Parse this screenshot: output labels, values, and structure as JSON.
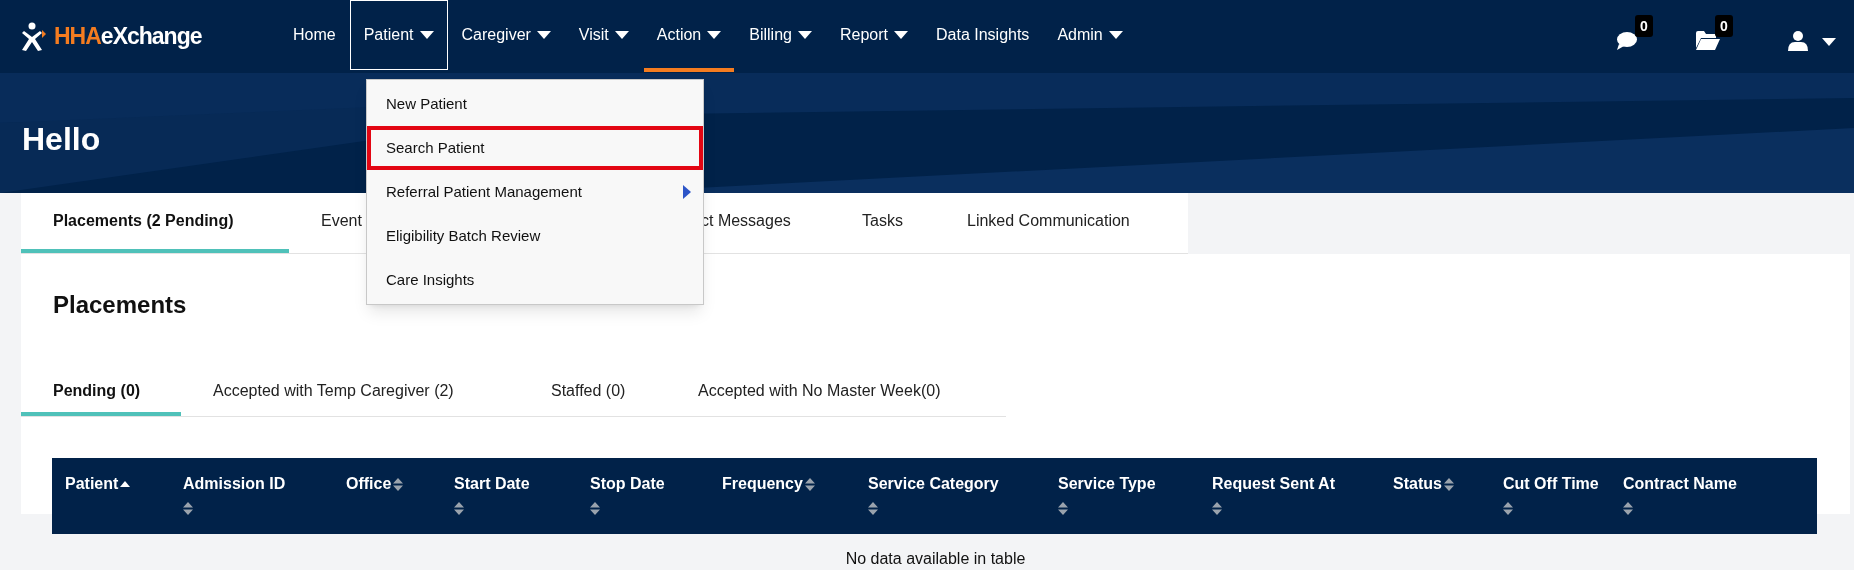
{
  "logo": {
    "prefix": "HHA",
    "suffix": "eXchange"
  },
  "nav": [
    {
      "label": "Home",
      "has_menu": false,
      "open": false,
      "active": false
    },
    {
      "label": "Patient",
      "has_menu": true,
      "open": true,
      "active": false
    },
    {
      "label": "Caregiver",
      "has_menu": true,
      "open": false,
      "active": false
    },
    {
      "label": "Visit",
      "has_menu": true,
      "open": false,
      "active": false
    },
    {
      "label": "Action",
      "has_menu": true,
      "open": false,
      "active": true
    },
    {
      "label": "Billing",
      "has_menu": true,
      "open": false,
      "active": false
    },
    {
      "label": "Report",
      "has_menu": true,
      "open": false,
      "active": false
    },
    {
      "label": "Data Insights",
      "has_menu": false,
      "open": false,
      "active": false
    },
    {
      "label": "Admin",
      "has_menu": true,
      "open": false,
      "active": false
    }
  ],
  "header_icons": [
    {
      "kind": "chat",
      "badge": "0"
    },
    {
      "kind": "folder",
      "badge": "0"
    },
    {
      "kind": "user"
    }
  ],
  "greeting": "Hello",
  "patient_menu": [
    {
      "label": "New Patient",
      "highlighted": false,
      "has_submenu": false
    },
    {
      "label": "Search Patient",
      "highlighted": true,
      "has_submenu": false
    },
    {
      "label": "Referral Patient Management",
      "highlighted": false,
      "has_submenu": true
    },
    {
      "label": "Eligibility Batch Review",
      "highlighted": false,
      "has_submenu": false
    },
    {
      "label": "Care Insights",
      "highlighted": false,
      "has_submenu": false
    }
  ],
  "tabs": [
    {
      "label": "Placements (2 Pending)",
      "selected": true
    },
    {
      "label": "Event",
      "selected": false
    },
    {
      "label": "ct Messages",
      "selected": false
    },
    {
      "label": "Tasks",
      "selected": false
    },
    {
      "label": "Linked Communication",
      "selected": false
    }
  ],
  "section_title": "Placements",
  "sub_tabs": [
    {
      "label": "Pending (0)",
      "selected": true
    },
    {
      "label": "Accepted with Temp Caregiver (2)",
      "selected": false
    },
    {
      "label": "Staffed (0)",
      "selected": false
    },
    {
      "label": "Accepted with No Master Week(0)",
      "selected": false
    }
  ],
  "table": {
    "columns": [
      {
        "label": "Patient",
        "sorted": true
      },
      {
        "label": "Admission ID",
        "sorted": false
      },
      {
        "label": "Office",
        "sorted": false
      },
      {
        "label": "Start Date",
        "sorted": false
      },
      {
        "label": "Stop Date",
        "sorted": false
      },
      {
        "label": "Frequency",
        "sorted": false
      },
      {
        "label": "Service Category",
        "sorted": false
      },
      {
        "label": "Service Type",
        "sorted": false
      },
      {
        "label": "Request Sent At",
        "sorted": false
      },
      {
        "label": "Status",
        "sorted": false
      },
      {
        "label": "Cut Off Time",
        "sorted": false
      },
      {
        "label": "Contract Name",
        "sorted": false
      }
    ],
    "empty_message": "No data available in table"
  }
}
